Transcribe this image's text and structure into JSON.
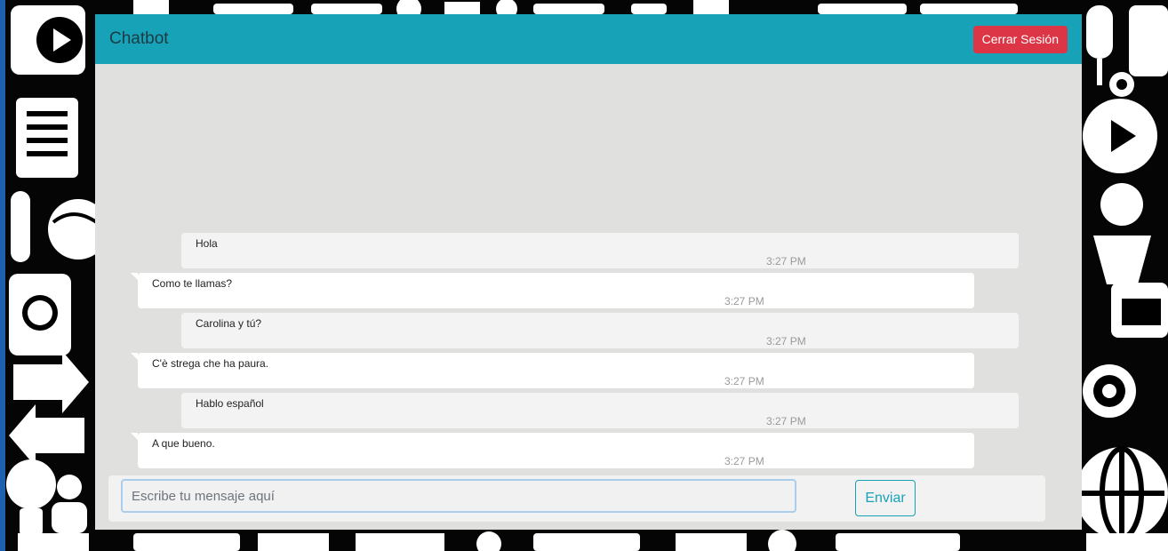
{
  "header": {
    "title": "Chatbot",
    "logout_label": "Cerrar Sesión"
  },
  "messages": [
    {
      "sender": "user",
      "text": "Hola",
      "time": "3:27 PM"
    },
    {
      "sender": "bot",
      "text": "Como te llamas?",
      "time": "3:27 PM"
    },
    {
      "sender": "user",
      "text": "Carolina y tú?",
      "time": "3:27 PM"
    },
    {
      "sender": "bot",
      "text": "C'è strega che ha paura.",
      "time": "3:27 PM"
    },
    {
      "sender": "user",
      "text": "Hablo español",
      "time": "3:27 PM"
    },
    {
      "sender": "bot",
      "text": "A que bueno.",
      "time": "3:27 PM"
    }
  ],
  "composer": {
    "placeholder": "Escribe tu mensaje aquí",
    "value": "",
    "send_label": "Enviar"
  },
  "colors": {
    "accent": "#17a2b8",
    "danger": "#dc3545",
    "chat_bg": "#e0e0de"
  },
  "background": {
    "icons": [
      "play-icon",
      "document-icon",
      "globe-icon",
      "chat-icon",
      "arrow-icon",
      "lightbulb-icon",
      "tv-icon",
      "person-icon",
      "star-icon",
      "gear-icon"
    ]
  }
}
